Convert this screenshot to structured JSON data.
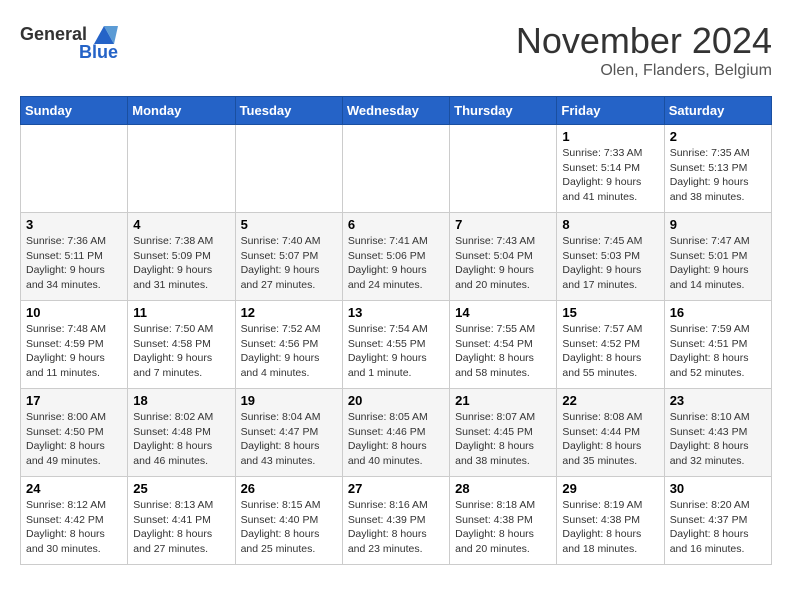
{
  "header": {
    "logo_general": "General",
    "logo_blue": "Blue",
    "month_title": "November 2024",
    "location": "Olen, Flanders, Belgium"
  },
  "days_of_week": [
    "Sunday",
    "Monday",
    "Tuesday",
    "Wednesday",
    "Thursday",
    "Friday",
    "Saturday"
  ],
  "weeks": [
    [
      {
        "day": "",
        "info": ""
      },
      {
        "day": "",
        "info": ""
      },
      {
        "day": "",
        "info": ""
      },
      {
        "day": "",
        "info": ""
      },
      {
        "day": "",
        "info": ""
      },
      {
        "day": "1",
        "info": "Sunrise: 7:33 AM\nSunset: 5:14 PM\nDaylight: 9 hours and 41 minutes."
      },
      {
        "day": "2",
        "info": "Sunrise: 7:35 AM\nSunset: 5:13 PM\nDaylight: 9 hours and 38 minutes."
      }
    ],
    [
      {
        "day": "3",
        "info": "Sunrise: 7:36 AM\nSunset: 5:11 PM\nDaylight: 9 hours and 34 minutes."
      },
      {
        "day": "4",
        "info": "Sunrise: 7:38 AM\nSunset: 5:09 PM\nDaylight: 9 hours and 31 minutes."
      },
      {
        "day": "5",
        "info": "Sunrise: 7:40 AM\nSunset: 5:07 PM\nDaylight: 9 hours and 27 minutes."
      },
      {
        "day": "6",
        "info": "Sunrise: 7:41 AM\nSunset: 5:06 PM\nDaylight: 9 hours and 24 minutes."
      },
      {
        "day": "7",
        "info": "Sunrise: 7:43 AM\nSunset: 5:04 PM\nDaylight: 9 hours and 20 minutes."
      },
      {
        "day": "8",
        "info": "Sunrise: 7:45 AM\nSunset: 5:03 PM\nDaylight: 9 hours and 17 minutes."
      },
      {
        "day": "9",
        "info": "Sunrise: 7:47 AM\nSunset: 5:01 PM\nDaylight: 9 hours and 14 minutes."
      }
    ],
    [
      {
        "day": "10",
        "info": "Sunrise: 7:48 AM\nSunset: 4:59 PM\nDaylight: 9 hours and 11 minutes."
      },
      {
        "day": "11",
        "info": "Sunrise: 7:50 AM\nSunset: 4:58 PM\nDaylight: 9 hours and 7 minutes."
      },
      {
        "day": "12",
        "info": "Sunrise: 7:52 AM\nSunset: 4:56 PM\nDaylight: 9 hours and 4 minutes."
      },
      {
        "day": "13",
        "info": "Sunrise: 7:54 AM\nSunset: 4:55 PM\nDaylight: 9 hours and 1 minute."
      },
      {
        "day": "14",
        "info": "Sunrise: 7:55 AM\nSunset: 4:54 PM\nDaylight: 8 hours and 58 minutes."
      },
      {
        "day": "15",
        "info": "Sunrise: 7:57 AM\nSunset: 4:52 PM\nDaylight: 8 hours and 55 minutes."
      },
      {
        "day": "16",
        "info": "Sunrise: 7:59 AM\nSunset: 4:51 PM\nDaylight: 8 hours and 52 minutes."
      }
    ],
    [
      {
        "day": "17",
        "info": "Sunrise: 8:00 AM\nSunset: 4:50 PM\nDaylight: 8 hours and 49 minutes."
      },
      {
        "day": "18",
        "info": "Sunrise: 8:02 AM\nSunset: 4:48 PM\nDaylight: 8 hours and 46 minutes."
      },
      {
        "day": "19",
        "info": "Sunrise: 8:04 AM\nSunset: 4:47 PM\nDaylight: 8 hours and 43 minutes."
      },
      {
        "day": "20",
        "info": "Sunrise: 8:05 AM\nSunset: 4:46 PM\nDaylight: 8 hours and 40 minutes."
      },
      {
        "day": "21",
        "info": "Sunrise: 8:07 AM\nSunset: 4:45 PM\nDaylight: 8 hours and 38 minutes."
      },
      {
        "day": "22",
        "info": "Sunrise: 8:08 AM\nSunset: 4:44 PM\nDaylight: 8 hours and 35 minutes."
      },
      {
        "day": "23",
        "info": "Sunrise: 8:10 AM\nSunset: 4:43 PM\nDaylight: 8 hours and 32 minutes."
      }
    ],
    [
      {
        "day": "24",
        "info": "Sunrise: 8:12 AM\nSunset: 4:42 PM\nDaylight: 8 hours and 30 minutes."
      },
      {
        "day": "25",
        "info": "Sunrise: 8:13 AM\nSunset: 4:41 PM\nDaylight: 8 hours and 27 minutes."
      },
      {
        "day": "26",
        "info": "Sunrise: 8:15 AM\nSunset: 4:40 PM\nDaylight: 8 hours and 25 minutes."
      },
      {
        "day": "27",
        "info": "Sunrise: 8:16 AM\nSunset: 4:39 PM\nDaylight: 8 hours and 23 minutes."
      },
      {
        "day": "28",
        "info": "Sunrise: 8:18 AM\nSunset: 4:38 PM\nDaylight: 8 hours and 20 minutes."
      },
      {
        "day": "29",
        "info": "Sunrise: 8:19 AM\nSunset: 4:38 PM\nDaylight: 8 hours and 18 minutes."
      },
      {
        "day": "30",
        "info": "Sunrise: 8:20 AM\nSunset: 4:37 PM\nDaylight: 8 hours and 16 minutes."
      }
    ]
  ]
}
